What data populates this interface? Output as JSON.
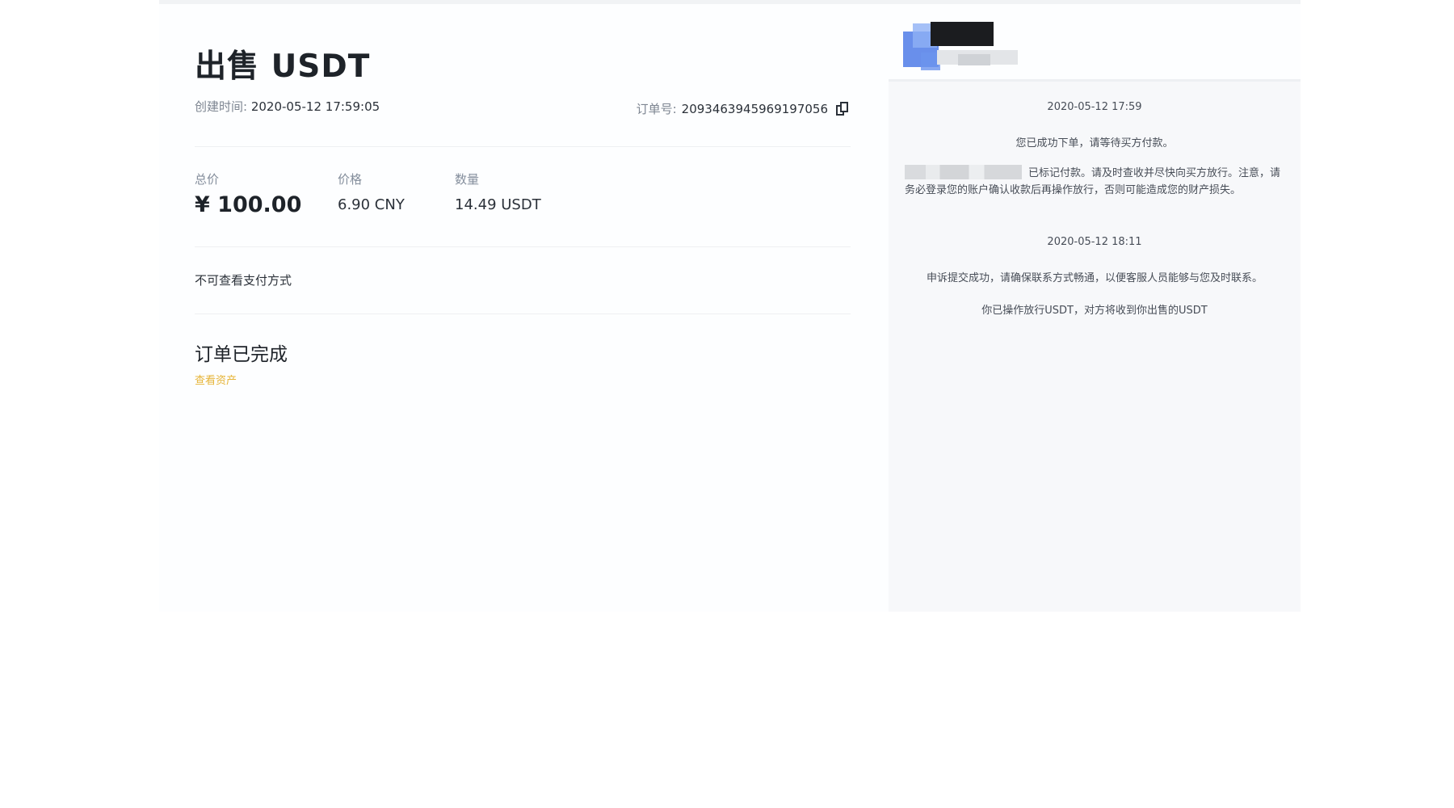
{
  "order": {
    "title": "出售 USDT",
    "created_label": "创建时间:",
    "created_value": "2020-05-12 17:59:05",
    "order_no_label": "订单号:",
    "order_no_value": "20934639459691970​56",
    "stats": [
      {
        "label": "总价",
        "value": "¥ 100.00"
      },
      {
        "label": "价格",
        "value": "6.90 CNY"
      },
      {
        "label": "数量",
        "value": "14.49 USDT"
      }
    ],
    "payment_note": "不可查看支付方式",
    "status_title": "订单已完成",
    "view_assets_link": "查看资产"
  },
  "chat": {
    "messages": [
      {
        "time": "2020-05-12 17:59"
      },
      {
        "text": "您已成功下单，请等待买方付款。"
      },
      {
        "text": "已标记付款。请及时查收并尽快向买方放行。注意，请务必登录您的账户确认收款后再操作放行，否则可能造成您的财产损失。"
      },
      {
        "time": "2020-05-12 18:11"
      },
      {
        "text": "申诉提交成功，请确保联系方式畅通，以便客服人员能够与您及时联系。"
      },
      {
        "text": "你已操作放行USDT，对方将收到你出售的USDT"
      }
    ]
  },
  "icons": {
    "copy": "copy-icon",
    "avatar": "avatar"
  }
}
